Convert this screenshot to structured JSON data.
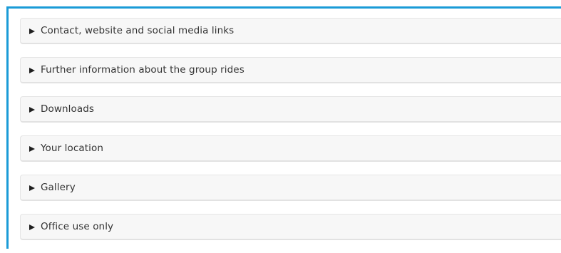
{
  "sections": [
    {
      "label": "Contact, website and social media links",
      "expanded": false
    },
    {
      "label": "Further information about the group rides",
      "expanded": false
    },
    {
      "label": "Downloads",
      "expanded": false
    },
    {
      "label": "Your location",
      "expanded": false
    },
    {
      "label": "Gallery",
      "expanded": false
    },
    {
      "label": "Office use only",
      "expanded": false
    }
  ],
  "colors": {
    "frame_accent": "#1a9bd7",
    "section_background": "#f7f7f7",
    "section_border": "#e5e5e5",
    "label_text": "#333333"
  },
  "icons": {
    "disclosure": "triangle-right-icon"
  }
}
